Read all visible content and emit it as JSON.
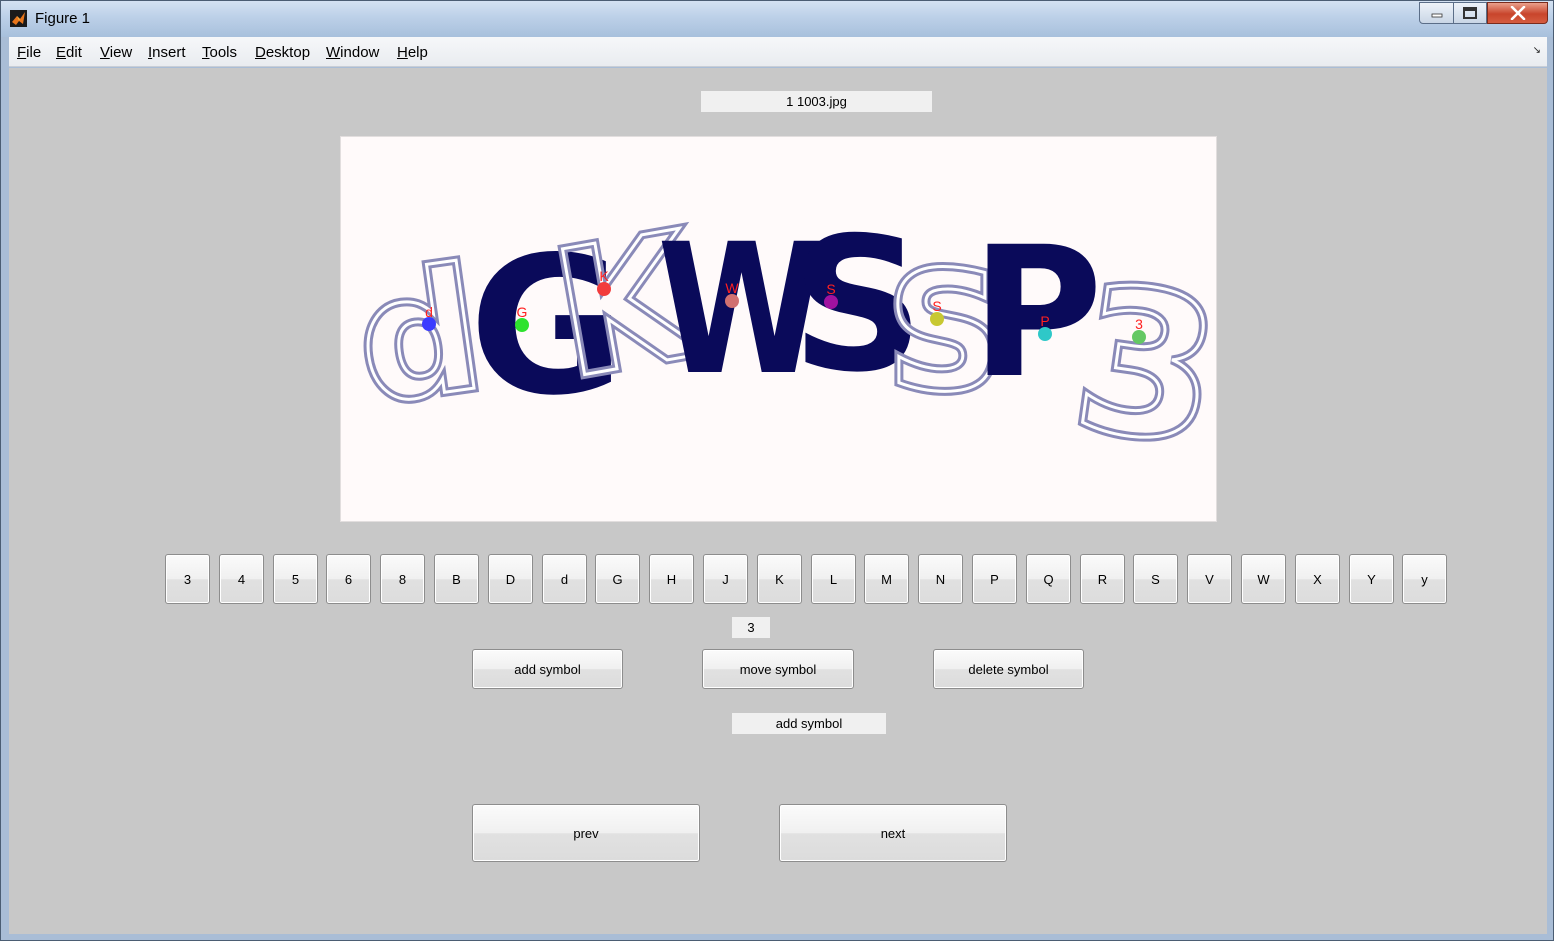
{
  "window": {
    "title": "Figure 1"
  },
  "menu": [
    "File",
    "Edit",
    "View",
    "Insert",
    "Tools",
    "Desktop",
    "Window",
    "Help"
  ],
  "file_label": "1  1003.jpg",
  "captcha": {
    "text": "dGKWSSP3",
    "markers": [
      {
        "label": "d",
        "color": "#3b3bff"
      },
      {
        "label": "G",
        "color": "#2ee22e"
      },
      {
        "label": "K",
        "color": "#f23c3c"
      },
      {
        "label": "W",
        "color": "#d07070"
      },
      {
        "label": "S",
        "color": "#a012a0"
      },
      {
        "label": "S",
        "color": "#c8c832"
      },
      {
        "label": "P",
        "color": "#2ec8c8"
      },
      {
        "label": "3",
        "color": "#64c864"
      }
    ]
  },
  "symbol_buttons": [
    "3",
    "4",
    "5",
    "6",
    "8",
    "B",
    "D",
    "d",
    "G",
    "H",
    "J",
    "K",
    "L",
    "M",
    "N",
    "P",
    "Q",
    "R",
    "S",
    "V",
    "W",
    "X",
    "Y",
    "y"
  ],
  "selected_symbol": "3",
  "actions": {
    "add": "add symbol",
    "move": "move symbol",
    "delete": "delete symbol"
  },
  "mode_label": "add symbol",
  "nav": {
    "prev": "prev",
    "next": "next"
  },
  "colors": {
    "captcha_ink": "#0a0a5a",
    "captcha_outline": "#8080b0",
    "figure_bg": "#c8c8c8"
  }
}
